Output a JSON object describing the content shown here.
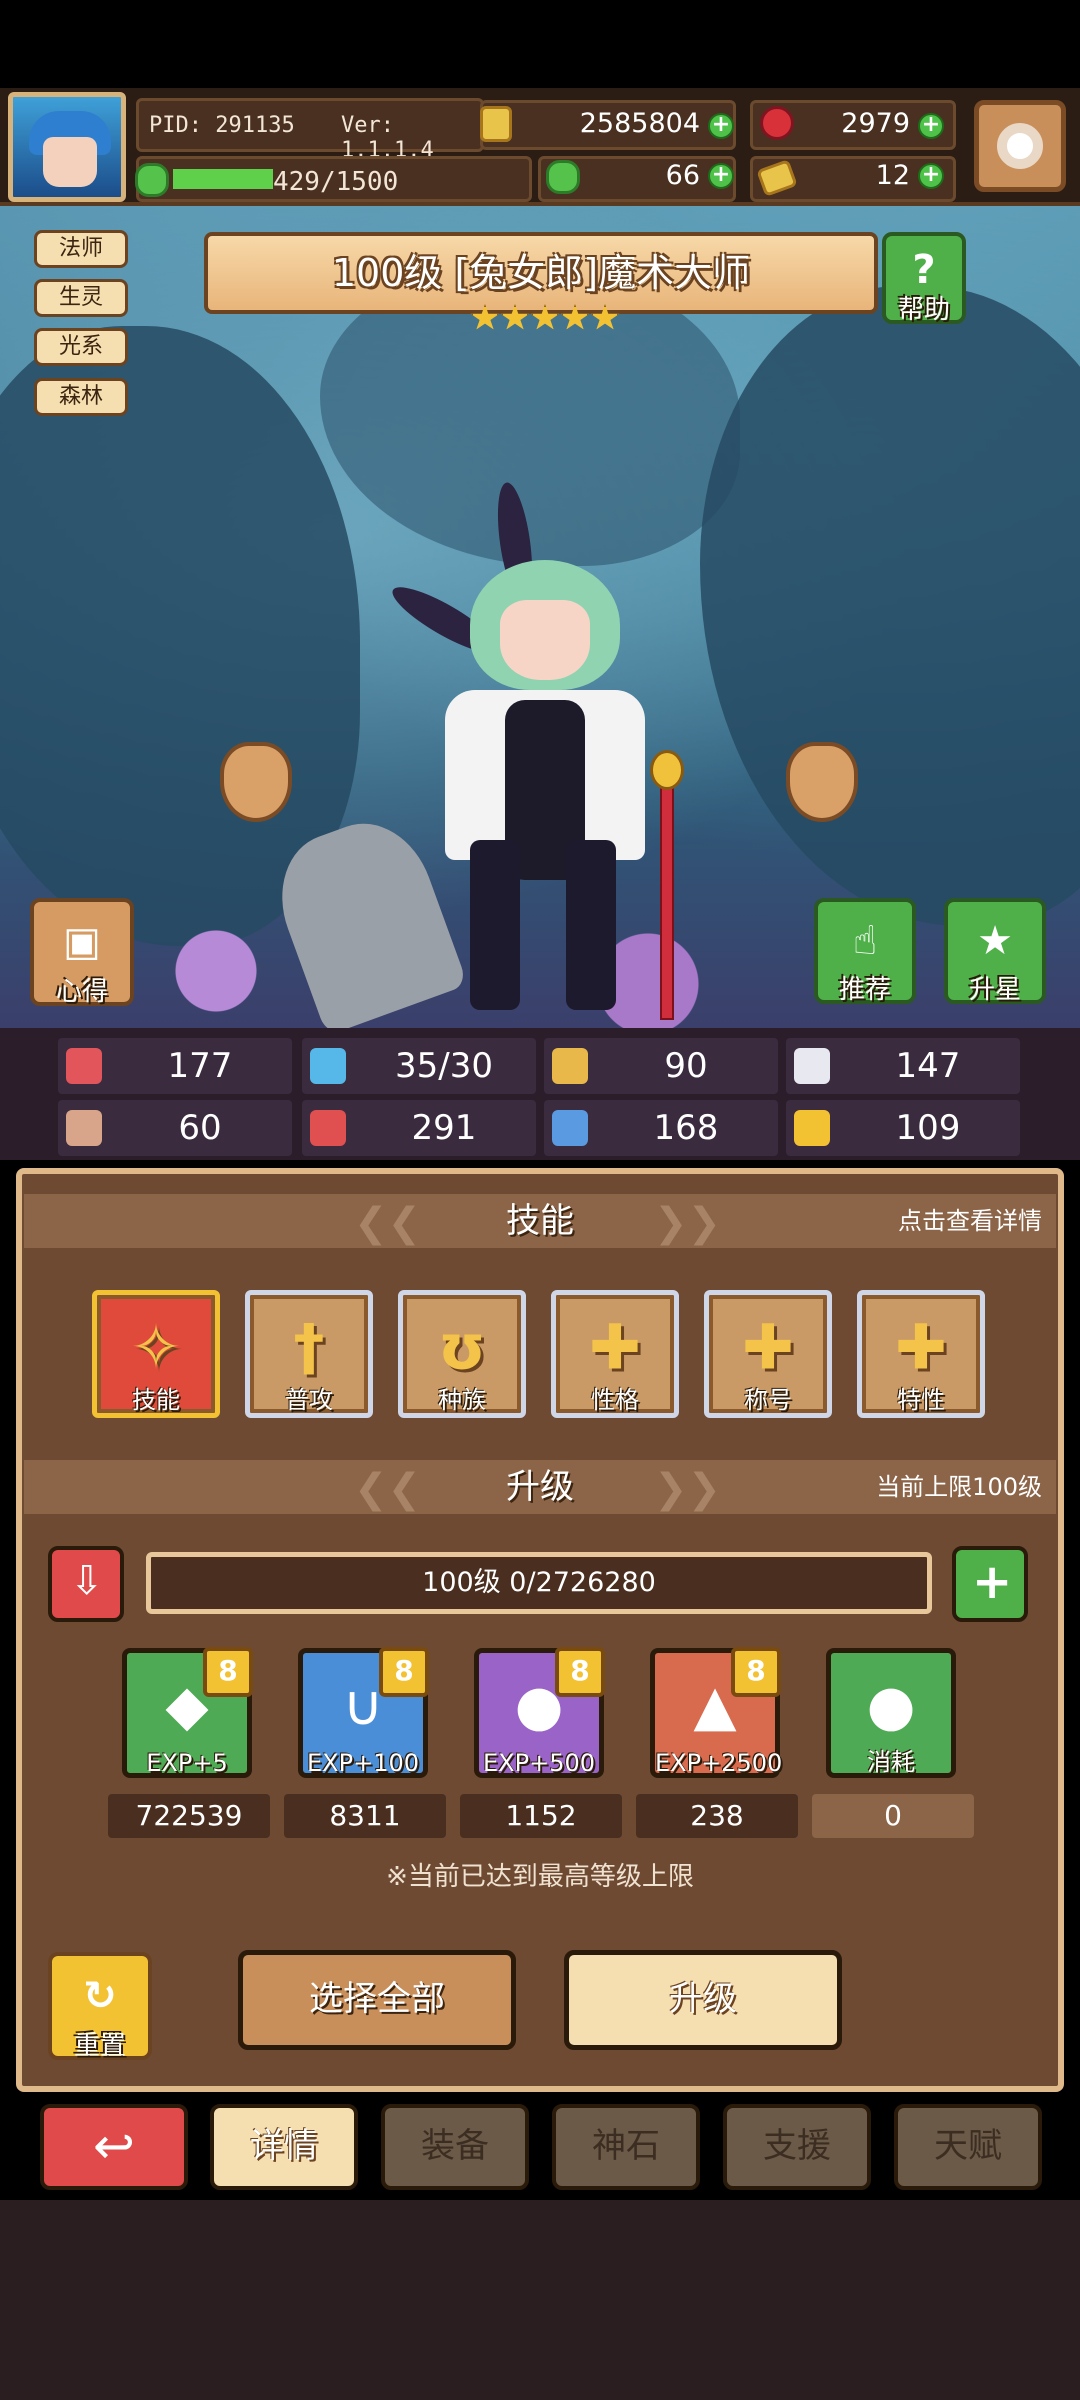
{
  "hud": {
    "pid": "PID: 291135",
    "version": "Ver: 1.1.1.4",
    "stamina": "429/1500",
    "stamina_fraction": 0.286,
    "gold": "2585804",
    "gems": "2979",
    "clover": "66",
    "keys": "12"
  },
  "tags": [
    "法师",
    "生灵",
    "光系",
    "森林"
  ],
  "banner": {
    "title": "100级 [兔女郎]魔术大师",
    "stars": 5
  },
  "buttons": {
    "help": "帮助",
    "tips": "心得",
    "recommend": "推荐",
    "upgrade_star": "升星"
  },
  "stats": [
    {
      "icon": "heart-icon",
      "value": "177",
      "color": "#e2555b"
    },
    {
      "icon": "mana-drop-icon",
      "value": "35/30",
      "color": "#55b8e8"
    },
    {
      "icon": "shield-icon",
      "value": "90",
      "color": "#e8b94a"
    },
    {
      "icon": "wing-icon",
      "value": "147",
      "color": "#e8e8f0"
    },
    {
      "icon": "fist-icon",
      "value": "60",
      "color": "#d9a58a"
    },
    {
      "icon": "book-icon",
      "value": "291",
      "color": "#e05050"
    },
    {
      "icon": "boot-icon",
      "value": "168",
      "color": "#5a9ae0"
    },
    {
      "icon": "horseshoe-icon",
      "value": "109",
      "color": "#f2c233"
    }
  ],
  "skills_section": {
    "title": "技能",
    "hint": "点击查看详情",
    "items": [
      {
        "label": "技能",
        "glyph": "✧",
        "active": true
      },
      {
        "label": "普攻",
        "glyph": "†",
        "active": false
      },
      {
        "label": "种族",
        "glyph": "ʊ",
        "active": false
      },
      {
        "label": "性格",
        "glyph": "✚",
        "active": false
      },
      {
        "label": "称号",
        "glyph": "✚",
        "active": false
      },
      {
        "label": "特性",
        "glyph": "✚",
        "active": false
      }
    ]
  },
  "level_section": {
    "title": "升级",
    "hint": "当前上限100级",
    "progress": "100级 0/2726280",
    "items": [
      {
        "label": "EXP+5",
        "count": "722539",
        "color": "#4faa55",
        "glyph": "◆"
      },
      {
        "label": "EXP+100",
        "count": "8311",
        "color": "#4b8ed8",
        "glyph": "∪"
      },
      {
        "label": "EXP+500",
        "count": "1152",
        "color": "#9a63c8",
        "glyph": "●"
      },
      {
        "label": "EXP+2500",
        "count": "238",
        "color": "#d86a4e",
        "glyph": "▲"
      },
      {
        "label": "消耗",
        "count": "0",
        "color": "#4faa55",
        "glyph": "●"
      }
    ],
    "badge": "8",
    "note": "※当前已达到最高等级上限"
  },
  "actions": {
    "reset": "重置",
    "select_all": "选择全部",
    "level_up": "升级"
  },
  "tabs": [
    {
      "label": "详情",
      "active": true
    },
    {
      "label": "装备",
      "active": false
    },
    {
      "label": "神石",
      "active": false
    },
    {
      "label": "支援",
      "active": false
    },
    {
      "label": "天赋",
      "active": false
    }
  ]
}
